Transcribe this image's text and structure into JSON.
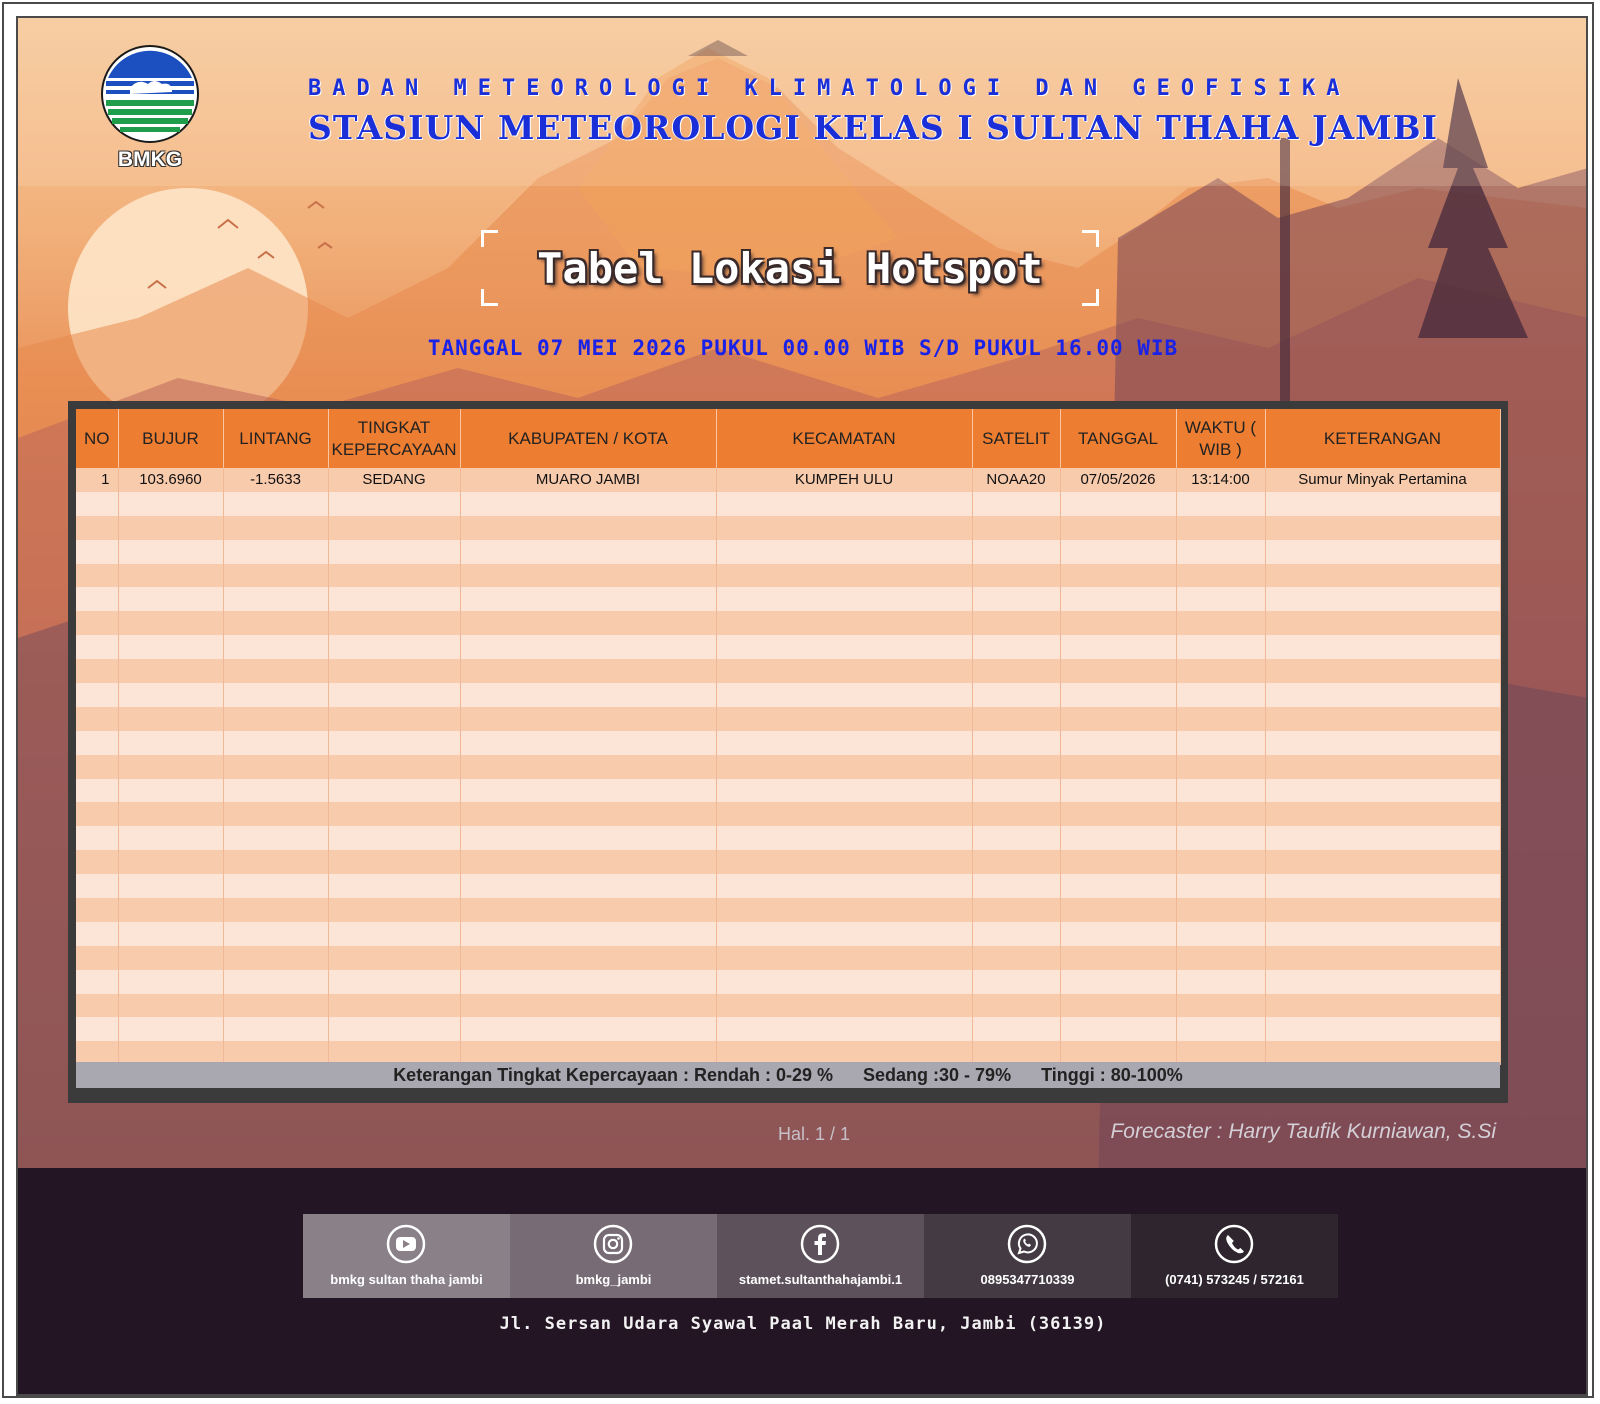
{
  "header": {
    "logo_text": "BMKG",
    "org_line1": "BADAN METEOROLOGI KLIMATOLOGI DAN GEOFISIKA",
    "org_line2": "STASIUN METEOROLOGI KELAS I SULTAN THAHA JAMBI"
  },
  "title": "Tabel Lokasi Hotspot",
  "date_line": "TANGGAL 07 MEI 2026 PUKUL 00.00 WIB S/D PUKUL 16.00 WIB",
  "table": {
    "columns": [
      "NO",
      "BUJUR",
      "LINTANG",
      "TINGKAT KEPERCAYAAN",
      "KABUPATEN / KOTA",
      "KECAMATAN",
      "SATELIT",
      "TANGGAL",
      "WAKTU ( WIB )",
      "KETERANGAN"
    ],
    "rows": [
      [
        "1",
        "103.6960",
        "-1.5633",
        "SEDANG",
        "MUARO JAMBI",
        "KUMPEH ULU",
        "NOAA20",
        "07/05/2026",
        "13:14:00",
        "Sumur Minyak Pertamina"
      ]
    ]
  },
  "confidence_note": {
    "label": "Keterangan Tingkat Kepercayaan : Rendah : 0-29 %",
    "sedang": "Sedang :30 - 79%",
    "tinggi": "Tinggi : 80-100%"
  },
  "page": "Hal. 1 / 1",
  "forecaster": "Forecaster : Harry Taufik Kurniawan, S.Si",
  "social": [
    {
      "icon": "youtube-icon",
      "label": "bmkg sultan thaha jambi",
      "bg": "#8a8088"
    },
    {
      "icon": "instagram-icon",
      "label": "bmkg_jambi",
      "bg": "#776c76"
    },
    {
      "icon": "facebook-icon",
      "label": "stamet.sultanthahajambi.1",
      "bg": "#5d525c"
    },
    {
      "icon": "whatsapp-icon",
      "label": "0895347710339",
      "bg": "#443a44"
    },
    {
      "icon": "phone-icon",
      "label": "(0741) 573245 / 572161",
      "bg": "#2e252e"
    }
  ],
  "address": "Jl. Sersan Udara Syawal Paal Merah Baru, Jambi (36139)",
  "colors": {
    "header_blue": "#1a2fd8",
    "table_header": "#ed7d31",
    "row_odd": "#f8cbad",
    "row_even": "#fce4d6",
    "footer_bg": "#241524"
  }
}
